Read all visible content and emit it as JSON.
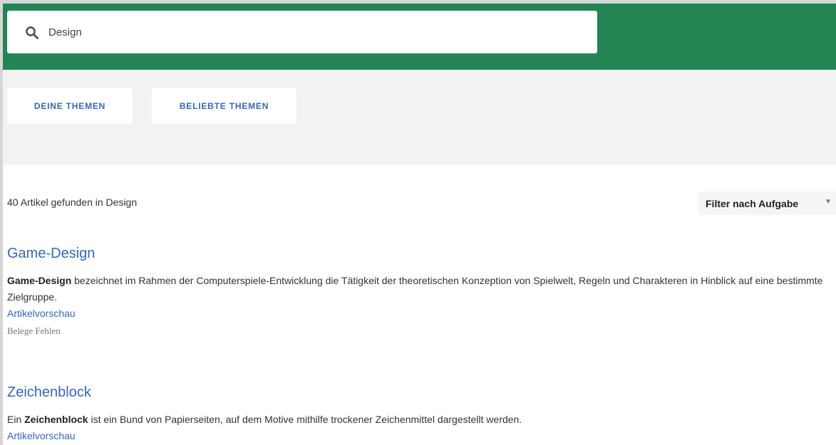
{
  "search": {
    "value": "Design",
    "icon": "search-icon"
  },
  "tabs": [
    {
      "label": "DEINE THEMEN"
    },
    {
      "label": "BELIEBTE THEMEN"
    }
  ],
  "results": {
    "count_text": "40 Artikel gefunden in Design",
    "filter_label": "Filter nach Aufgabe",
    "filter_arrow": "▼"
  },
  "articles": [
    {
      "title": "Game-Design",
      "snippet_bold": "Game-Design",
      "snippet_rest": " bezeichnet im Rahmen der Computerspiele-Entwicklung die Tätigkeit der theoretischen Konzeption von Spielwelt, Regeln und Charakteren in Hinblick auf eine bestimmte Zielgruppe.",
      "preview_label": "Artikelvorschau",
      "tag": "Belege Fehlen"
    },
    {
      "title": "Zeichenblock",
      "snippet_lead": "Ein ",
      "snippet_bold": "Zeichenblock",
      "snippet_rest": " ist ein Bund von Papierseiten, auf dem Motive mithilfe trockener Zeichenmittel dargestellt werden.",
      "preview_label": "Artikelvorschau"
    }
  ],
  "colors": {
    "header_green": "#238554",
    "link_blue": "#3366cc",
    "band_gray": "#f2f2f2"
  }
}
